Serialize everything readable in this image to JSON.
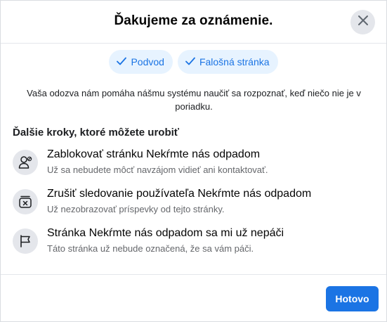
{
  "dialog": {
    "title": "Ďakujeme za oznámenie.",
    "close_icon": "close-icon"
  },
  "chips": [
    {
      "label": "Podvod",
      "icon": "checkmark-icon"
    },
    {
      "label": "Falošná stránka",
      "icon": "checkmark-icon"
    }
  ],
  "feedback_text": "Vaša odozva nám pomáha nášmu systému naučiť sa rozpoznať, keď niečo nie je v poriadku.",
  "next_steps": {
    "heading": "Ďalšie kroky, ktoré môžete urobiť",
    "items": [
      {
        "title": "Zablokovať stránku Nekŕmte nás odpadom",
        "description": "Už sa nebudete môcť navzájom vidieť ani kontaktovať.",
        "icon": "block-user-icon"
      },
      {
        "title": "Zrušiť sledovanie používateľa Nekŕmte nás odpadom",
        "description": "Už nezobrazovať príspevky od tejto stránky.",
        "icon": "unfollow-icon"
      },
      {
        "title": "Stránka Nekŕmte nás odpadom sa mi už nepáči",
        "description": "Táto stránka už nebude označená, že sa vám páči.",
        "icon": "flag-icon"
      }
    ]
  },
  "footer": {
    "done_label": "Hotovo"
  },
  "colors": {
    "accent": "#1b74e4",
    "chip_background": "#e7f3ff",
    "icon_background": "#e4e6eb",
    "secondary_text": "#65676b"
  }
}
